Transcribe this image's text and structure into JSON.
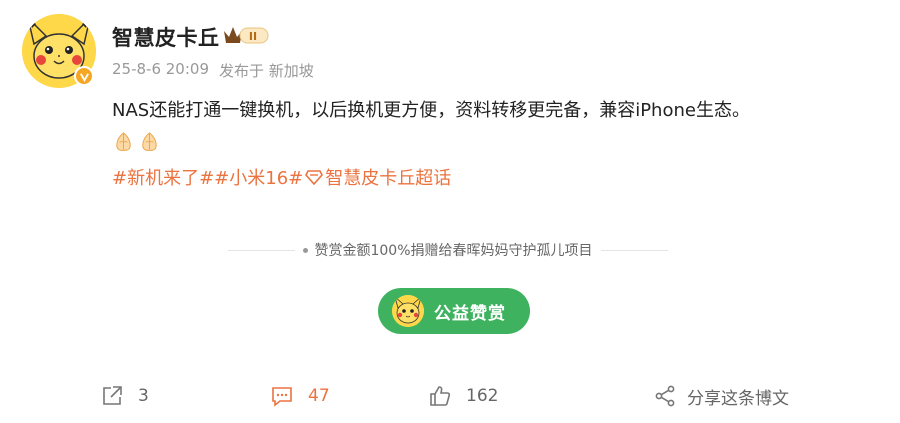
{
  "user": {
    "name": "智慧皮卡丘",
    "badge_text": "II",
    "timestamp": "25-8-6 20:09",
    "location": "发布于 新加坡"
  },
  "post": {
    "text": "NAS还能打通一键换机，以后换机更方便，资料转移更完备，兼容iPhone生态。",
    "topics": [
      "#新机来了#",
      "#小米16#",
      "智慧皮卡丘超话"
    ]
  },
  "donation": {
    "notice": "赞赏金额100%捐赠给春晖妈妈守护孤儿项目",
    "button_label": "公益赞赏"
  },
  "actions": {
    "repost_count": "3",
    "comment_count": "47",
    "like_count": "162",
    "share_label": "分享这条博文"
  },
  "colors": {
    "accent": "#eb7340",
    "charity_green": "#3fb260",
    "avatar_yellow": "#ffd84a"
  }
}
